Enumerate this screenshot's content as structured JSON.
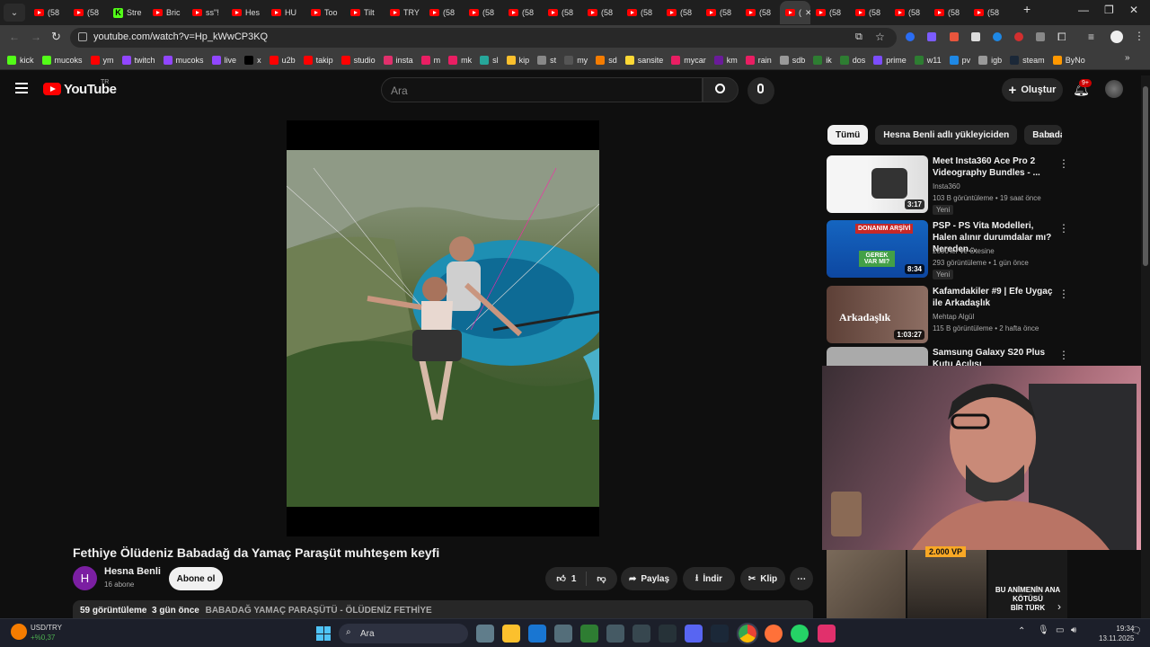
{
  "browser": {
    "tabs": [
      "(58",
      "(58",
      "Stre",
      "Bric",
      "ss\"!",
      "Hes",
      "HU",
      "Too",
      "Tilt",
      "TRY",
      "(58",
      "(58",
      "(58",
      "(58",
      "(58",
      "(58",
      "(58",
      "(58",
      "(58",
      "(",
      "(58",
      "(58",
      "(58",
      "(58",
      "(58"
    ],
    "url": "youtube.com/watch?v=Hp_kWwCP3KQ",
    "bookmarks": [
      "kick",
      "mucoks",
      "ym",
      "twitch",
      "mucoks",
      "live",
      "x",
      "u2b",
      "takip",
      "studio",
      "insta",
      "m",
      "mk",
      "sl",
      "kip",
      "st",
      "my",
      "sd",
      "sansite",
      "mycar",
      "km",
      "rain",
      "sdb",
      "ik",
      "dos",
      "prime",
      "w11",
      "pv",
      "igb",
      "steam",
      "ByNo"
    ]
  },
  "youtube": {
    "logo_text": "YouTube",
    "country": "TR",
    "search_placeholder": "Ara",
    "create_label": "Oluştur",
    "notif_count": "9+"
  },
  "video": {
    "title": "Fethiye Ölüdeniz Babadağ da Yamaç Paraşüt muhteşem keyfi",
    "channel": "Hesna Benli",
    "avatar_letter": "H",
    "subs": "16 abone",
    "subscribe_label": "Abone ol",
    "likes": "1",
    "share_label": "Paylaş",
    "download_label": "İndir",
    "clip_label": "Klip",
    "views": "59 görüntüleme",
    "age": "3 gün önce",
    "tags": "BABADAĞ YAMAÇ PARAŞÜTÜ - ÖLÜDENİZ FETHİYE"
  },
  "chips": [
    "Tümü",
    "Hesna Benli adlı yükleyiciden",
    "Babadağ"
  ],
  "recommendations": [
    {
      "title": "Meet Insta360 Ace Pro 2 Videography Bundles - ...",
      "channel": "Insta360",
      "meta": "103 B görüntüleme • 19 saat önce",
      "duration": "3:17",
      "badge": "Yeni"
    },
    {
      "title": "PSP - PS Vita Modelleri, Halen alınır durumdalar mı? Nereden...",
      "channel": "2000'ler ve Ötesine",
      "meta": "293 görüntüleme • 1 gün önce",
      "duration": "8:34",
      "badge": "Yeni",
      "thumb_text_1": "DONANIM ARŞİVİ",
      "thumb_text_2": "GEREK VAR MI?"
    },
    {
      "title": "Kafamdakiler #9 | Efe Uygaç ile Arkadaşlık",
      "channel": "Mehtap Algül",
      "meta": "115 B görüntüleme • 2 hafta önce",
      "duration": "1:03:27",
      "thumb_text": "Arkadaşlık"
    },
    {
      "title": "Samsung Galaxy S20 Plus Kutu Açılışı",
      "channel": "",
      "meta": ""
    }
  ],
  "shorts": {
    "overlay_text_1": "BU ANİMENİN ANA",
    "overlay_text_2": "KÖTÜSÜ",
    "overlay_text_3": "BİR TÜRK",
    "vp_text": "2.000 VP"
  },
  "taskbar": {
    "ticker": "USD/TRY",
    "ticker_change": "+%0,37",
    "search": "Ara",
    "time": "19:34",
    "date": "13.11.2025"
  }
}
